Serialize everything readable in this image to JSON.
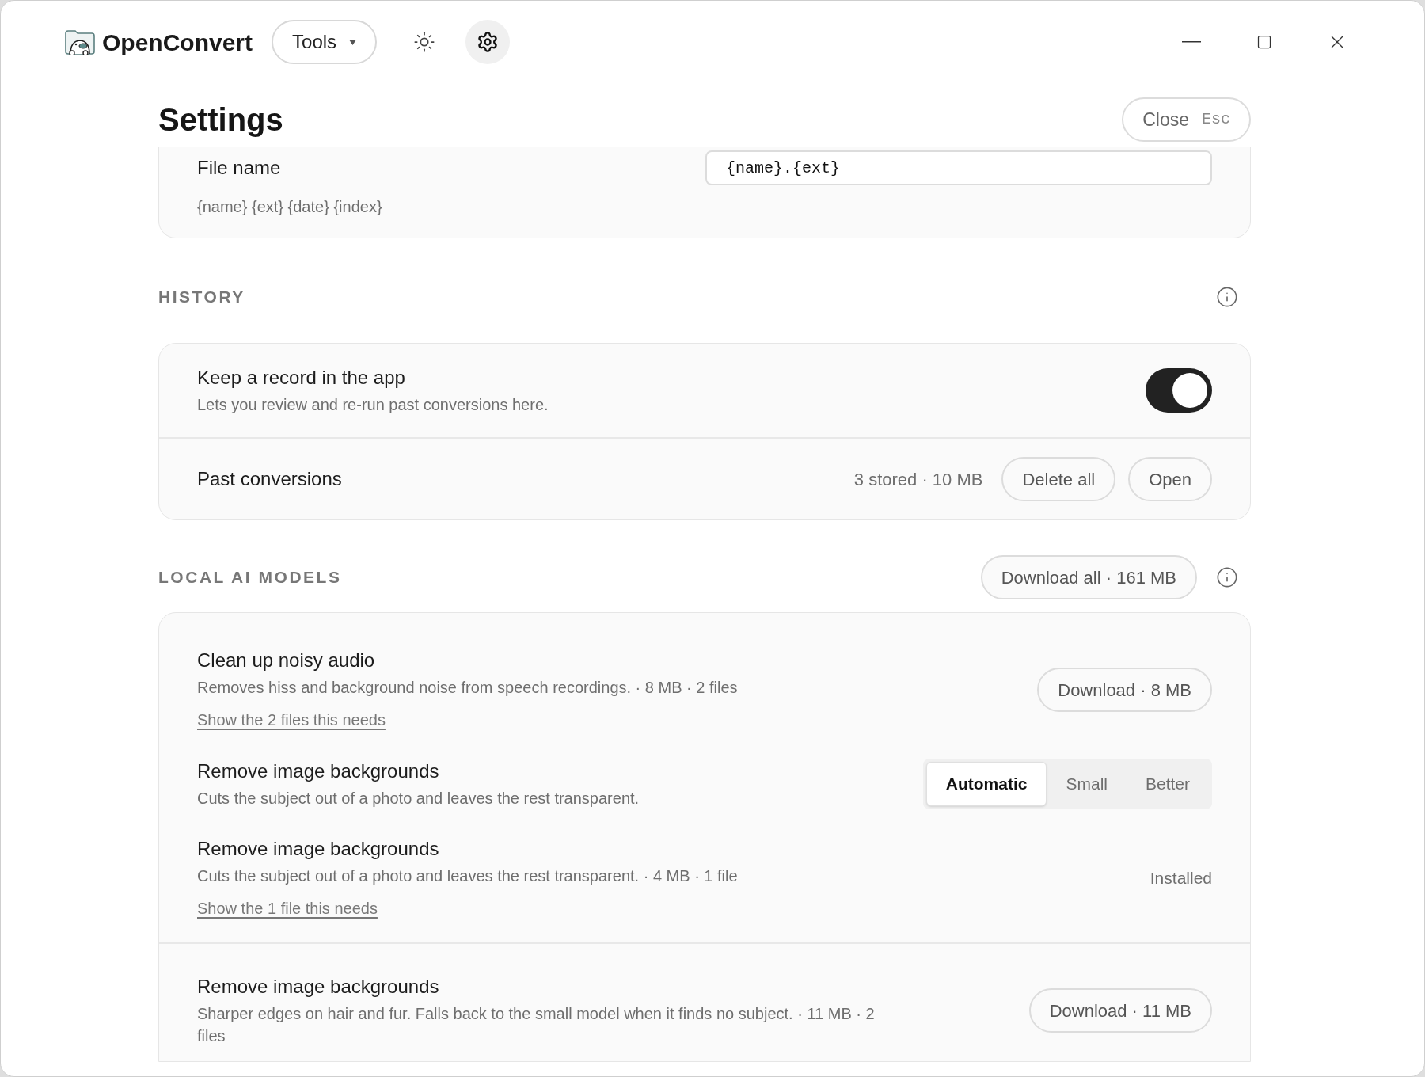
{
  "app": {
    "name": "OpenConvert",
    "tools_menu": "Tools"
  },
  "settings": {
    "title": "Settings",
    "close": {
      "label": "Close",
      "shortcut": "Esc"
    }
  },
  "file_name": {
    "label": "File name",
    "value": "{name}.{ext}",
    "hint": "{name} {ext} {date} {index}"
  },
  "history": {
    "title": "HISTORY",
    "rows": [
      {
        "kind": "toggle",
        "title": "Keep a record in the app",
        "description": "Lets you review and re-run past conversions here.",
        "on": true
      },
      {
        "kind": "actions",
        "title": "Past conversions",
        "summary": "3 stored · 10 MB",
        "buttons": [
          "Delete all",
          "Open"
        ]
      }
    ]
  },
  "models": {
    "title": "LOCAL AI MODELS",
    "download_all": "Download all · 161 MB",
    "groups": [
      {
        "items": [
          {
            "kind": "download",
            "title": "Clean up noisy audio",
            "description": "Removes hiss and background noise from speech recordings. · 8 MB · 2 files",
            "link": "Show the 2 files this needs",
            "button": "Download · 8 MB"
          },
          {
            "kind": "variant",
            "title": "Remove image backgrounds",
            "description": "Cuts the subject out of a photo and leaves the rest transparent.",
            "options": [
              {
                "label": "Automatic",
                "selected": true
              },
              {
                "label": "Small",
                "selected": false
              },
              {
                "label": "Better",
                "selected": false
              }
            ]
          },
          {
            "kind": "installed",
            "title": "Remove image backgrounds",
            "description": "Cuts the subject out of a photo and leaves the rest transparent. · 4 MB · 1 file",
            "link": "Show the 1 file this needs",
            "status": "Installed"
          }
        ]
      },
      {
        "items": [
          {
            "kind": "download",
            "title": "Remove image backgrounds",
            "description": "Sharper edges on hair and fur. Falls back to the small model when it finds no subject. · 11 MB · 2 files",
            "button": "Download · 11 MB"
          }
        ]
      }
    ]
  }
}
